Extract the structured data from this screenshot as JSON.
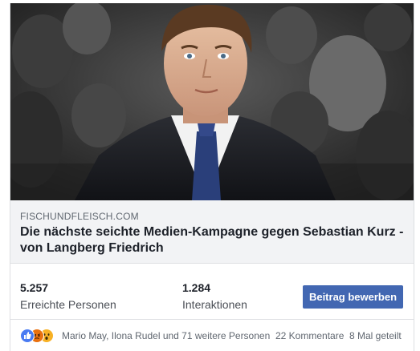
{
  "link_preview": {
    "domain": "FISCHUNDFLEISCH.COM",
    "headline": "Die nächste seichte Medien-Kampagne gegen Sebastian Kurz - von Langberg Friedrich"
  },
  "insights": {
    "reach_value": "5.257",
    "reach_label": "Erreichte Personen",
    "engagement_value": "1.284",
    "engagement_label": "Interaktionen",
    "boost_button": "Beitrag bewerben"
  },
  "social": {
    "reaction_icons": [
      "like-icon",
      "angry-icon",
      "wow-icon"
    ],
    "reactors": "Mario May, Ilona Rudel und 71 weitere Personen",
    "comments": "22 Kommentare",
    "shares": "8 Mal geteilt"
  },
  "colors": {
    "accent": "#4267b2",
    "like": "#4a7bf2",
    "angry": "#e9710f",
    "wow": "#f7b125"
  }
}
